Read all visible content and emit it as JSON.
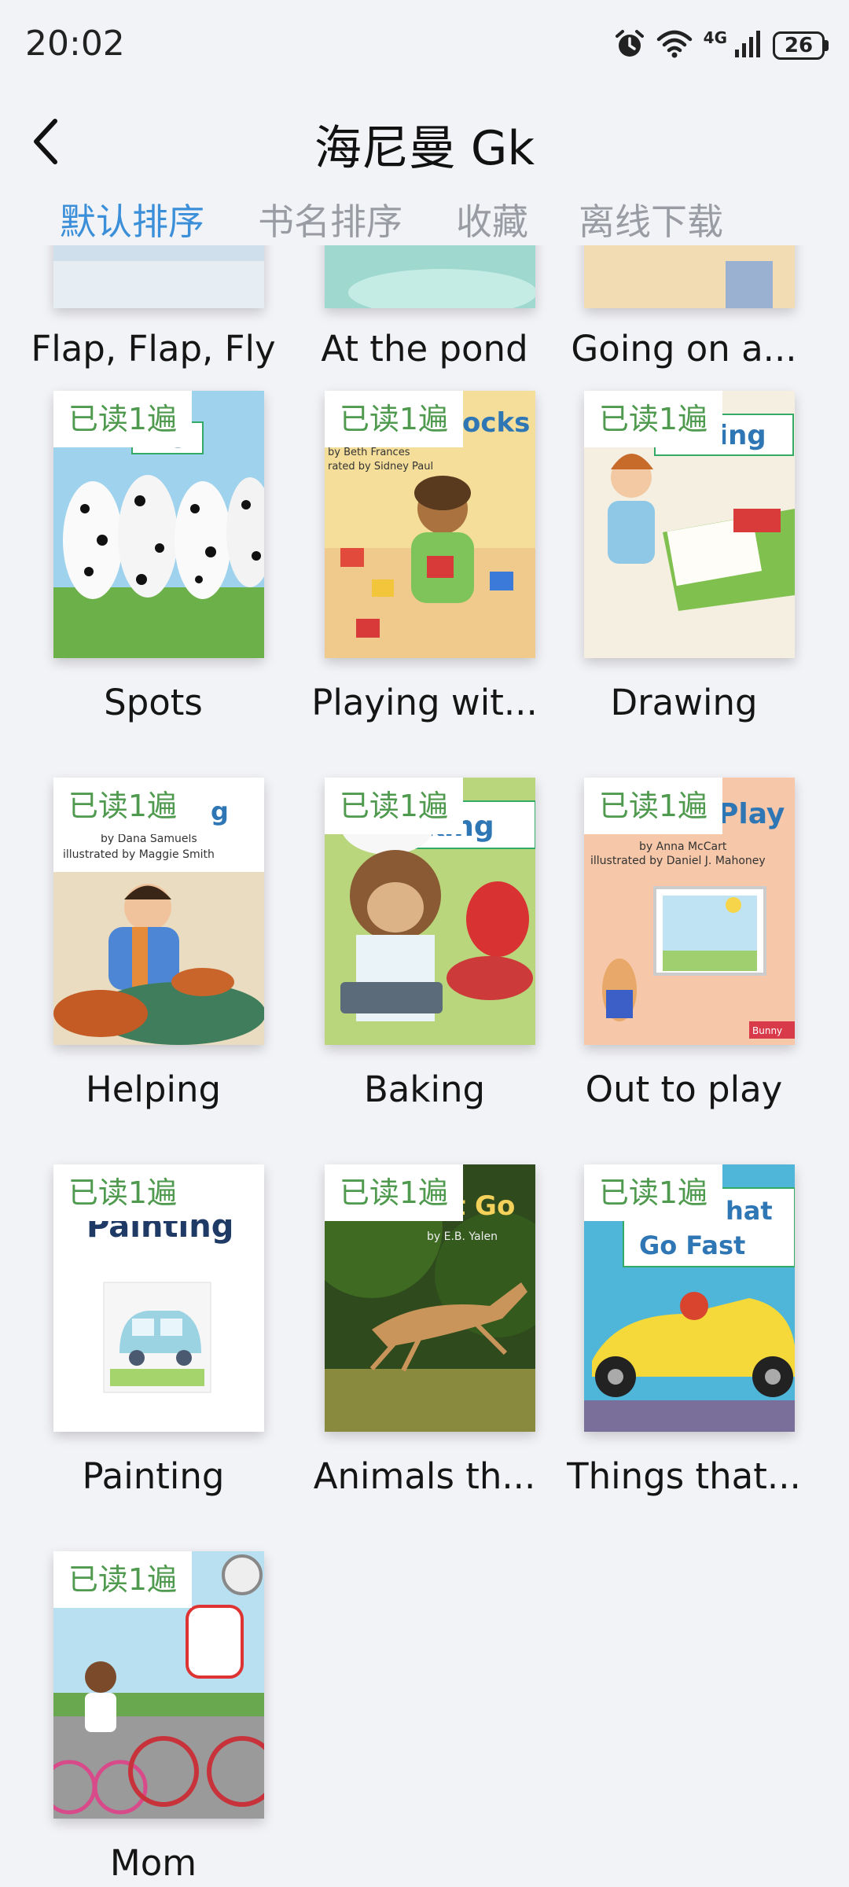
{
  "status_bar": {
    "time": "20:02",
    "network": "4G",
    "battery": "26"
  },
  "header": {
    "title": "海尼曼 Gk"
  },
  "tabs": [
    {
      "label": "默认排序"
    },
    {
      "label": "书名排序"
    },
    {
      "label": "收藏"
    },
    {
      "label": "离线下载"
    }
  ],
  "colors": {
    "accent": "#3b8fd9",
    "badge_text": "#4f9a4e",
    "background": "#f2f3f7"
  },
  "books": [
    {
      "title": "Flap, Flap, Fly"
    },
    {
      "title": "At the pond"
    },
    {
      "title": "Going on a..."
    },
    {
      "title": "Spots",
      "badge": "已读1遍",
      "cover_text": "s"
    },
    {
      "title": "Playing wit...",
      "badge": "已读1遍",
      "cover_text": "ocks",
      "cover_byline1": "by Beth Frances",
      "cover_byline2": "rated by Sidney Paul"
    },
    {
      "title": "Drawing",
      "badge": "已读1遍",
      "cover_text": "wing"
    },
    {
      "title": "Helping",
      "badge": "已读1遍",
      "cover_text": "g",
      "cover_byline1": "by Dana Samuels",
      "cover_byline2": "illustrated by Maggie Smith"
    },
    {
      "title": "Baking",
      "badge": "已读1遍",
      "cover_text": "king"
    },
    {
      "title": "Out to play",
      "badge": "已读1遍",
      "cover_text": "Play",
      "cover_byline1": "by Anna McCart",
      "cover_byline2": "illustrated by Daniel J. Mahoney",
      "cover_corner": "Bunny"
    },
    {
      "title": "Painting",
      "badge": "已读1遍",
      "cover_text": "Painting"
    },
    {
      "title": "Animals th...",
      "badge": "已读1遍",
      "cover_text": "at Go",
      "cover_byline1": "by E.B. Yalen"
    },
    {
      "title": "Things that...",
      "badge": "已读1遍",
      "cover_text": "hat",
      "cover_text2": "Go Fast"
    },
    {
      "title": "Mom",
      "badge": "已读1遍"
    }
  ]
}
